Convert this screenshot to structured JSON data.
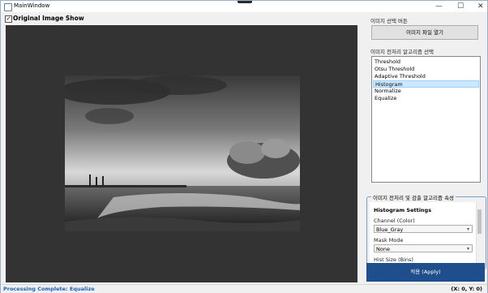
{
  "window": {
    "title": "MainWindow",
    "minimize": "—",
    "maximize": "☐",
    "close": "✕"
  },
  "left": {
    "show_original_label": "Original Image Show",
    "show_original_checked": true
  },
  "right": {
    "open_section_label": "이미지 선택 버튼",
    "open_button": "이미지 파일 열기",
    "algo_section_label": "이미지 전처리 알고리즘 선택",
    "algorithms": [
      "Threshold",
      "Otsu Threshold",
      "Adaptive Threshold",
      "Histogram",
      "Normalize",
      "Equalize"
    ],
    "selected_algorithm_index": 3,
    "props_group_title": "이미지 전처리 및 검출 알고리즘 속성",
    "props": {
      "heading": "Histogram Settings",
      "channel_label": "Channel (Color)",
      "channel_value": "Blue_Gray",
      "mask_label": "Mask Mode",
      "mask_value": "None",
      "hist_size_label": "Hist Size (Bins)"
    },
    "apply_button": "적용 (Apply)"
  },
  "status": {
    "message": "Processing Complete: Equalize",
    "coords": "(X: 0, Y: 0)"
  }
}
